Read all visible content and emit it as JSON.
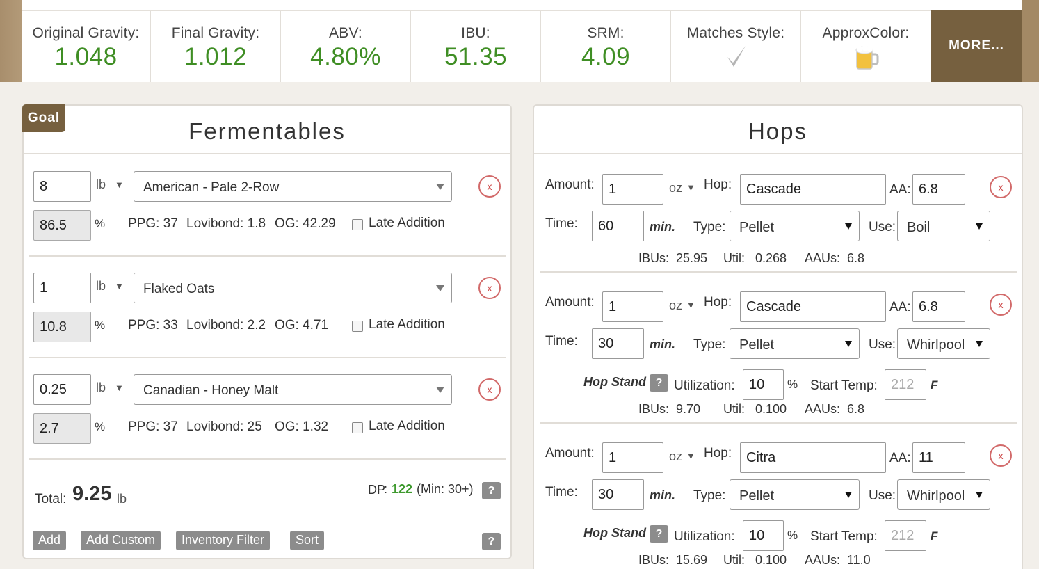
{
  "stats": [
    {
      "label": "Original Gravity:",
      "value": "1.048"
    },
    {
      "label": "Final Gravity:",
      "value": "1.012"
    },
    {
      "label": "ABV:",
      "value": "4.80%"
    },
    {
      "label": "IBU:",
      "value": "51.35"
    },
    {
      "label": "SRM:",
      "value": "4.09"
    },
    {
      "label": "Matches Style:",
      "icon": "checkmark-icon"
    },
    {
      "label": "ApproxColor:",
      "icon": "beer-mug-icon",
      "color": "#f2c13e"
    }
  ],
  "more_label": "MORE...",
  "fermentables": {
    "goal_label": "Goal",
    "title": "Fermentables",
    "rows": [
      {
        "amount": "8",
        "unit": "lb",
        "grain": "American - Pale 2-Row",
        "percent": "86.5",
        "pct_sign": "%",
        "ppg": "PPG: 37",
        "lovibond": "Lovibond: 1.8",
        "og": "OG: 42.29",
        "late_label": "Late Addition",
        "remove": "x"
      },
      {
        "amount": "1",
        "unit": "lb",
        "grain": "Flaked Oats",
        "percent": "10.8",
        "pct_sign": "%",
        "ppg": "PPG: 33",
        "lovibond": "Lovibond: 2.2",
        "og": "OG: 4.71",
        "late_label": "Late Addition",
        "remove": "x"
      },
      {
        "amount": "0.25",
        "unit": "lb",
        "grain": "Canadian - Honey Malt",
        "percent": "2.7",
        "pct_sign": "%",
        "ppg": "PPG: 37",
        "lovibond": "Lovibond: 25",
        "og": "OG: 1.32",
        "late_label": "Late Addition",
        "remove": "x"
      }
    ],
    "total_label": "Total:",
    "total_value": "9.25",
    "total_unit": "lb",
    "dp_label": "DP",
    "dp_colon": ":",
    "dp_value": "122",
    "dp_min": "(Min: 30+)",
    "help": "?",
    "buttons": {
      "add": "Add",
      "add_custom": "Add Custom",
      "inventory_filter": "Inventory Filter",
      "sort": "Sort"
    }
  },
  "hops": {
    "title": "Hops",
    "labels": {
      "amount": "Amount:",
      "hop": "Hop:",
      "aa": "AA:",
      "time": "Time:",
      "min": "min.",
      "type": "Type:",
      "use": "Use:",
      "hop_stand": "Hop Stand",
      "utilization": "Utilization:",
      "pct": "%",
      "start_temp": "Start Temp:",
      "temp_unit": "F",
      "ibus": "IBUs:",
      "util": "Util:",
      "aaus": "AAUs:",
      "help": "?",
      "remove": "x"
    },
    "rows": [
      {
        "amount": "1",
        "unit": "oz",
        "hop": "Cascade",
        "aa": "6.8",
        "time": "60",
        "type": "Pellet",
        "use": "Boil",
        "ibus": "25.95",
        "util": "0.268",
        "aaus": "6.8"
      },
      {
        "amount": "1",
        "unit": "oz",
        "hop": "Cascade",
        "aa": "6.8",
        "time": "30",
        "type": "Pellet",
        "use": "Whirlpool",
        "utilization": "10",
        "start_temp": "212",
        "ibus": "9.70",
        "util": "0.100",
        "aaus": "6.8"
      },
      {
        "amount": "1",
        "unit": "oz",
        "hop": "Citra",
        "aa": "11",
        "time": "30",
        "type": "Pellet",
        "use": "Whirlpool",
        "utilization": "10",
        "start_temp": "212",
        "ibus": "15.69",
        "util": "0.100",
        "aaus": "11.0"
      }
    ]
  }
}
